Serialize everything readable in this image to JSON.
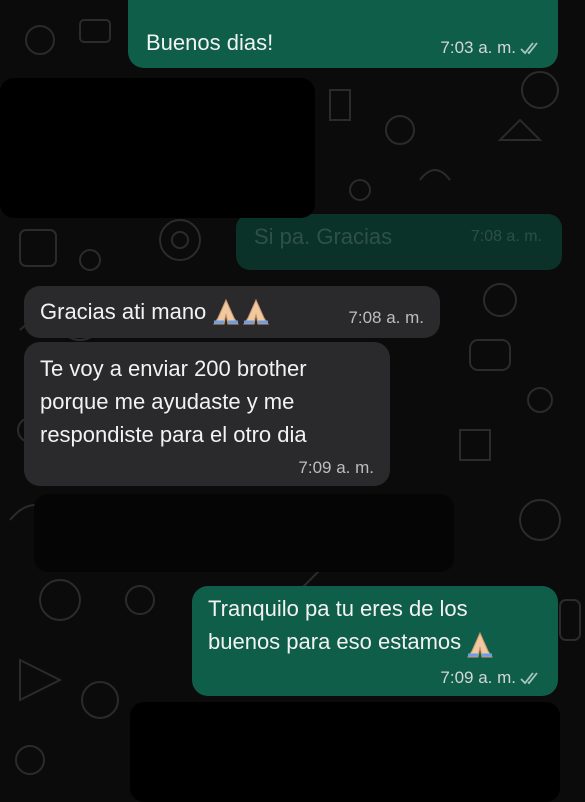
{
  "messages": [
    {
      "id": "m1",
      "side": "out",
      "text": "Buenos dias!",
      "time": "7:03 a. m.",
      "ticks": true
    },
    {
      "id": "m2",
      "side": "out",
      "text": "Si pa. Gracias",
      "time": "7:08 a. m.",
      "ticks": true,
      "blurred": true
    },
    {
      "id": "m3",
      "side": "in",
      "text": "Gracias ati mano",
      "emoji": "folded-hands-x2",
      "time": "7:08 a. m."
    },
    {
      "id": "m4",
      "side": "in",
      "text": "Te voy a enviar 200 brother\nporque me ayudaste y me\nrespondiste para el otro dia",
      "time": "7:09 a. m."
    },
    {
      "id": "m5",
      "side": "out",
      "text": "Tranquilo pa tu eres de los\nbuenos para eso estamos",
      "emoji": "folded-hands",
      "time": "7:09 a. m.",
      "ticks": true
    }
  ],
  "colors": {
    "background": "#0b0b0b",
    "outgoing": "#0f5e4a",
    "incoming": "#2a2a2c",
    "text": "#f2f2f2"
  },
  "icons": [
    "double-check-icon",
    "folded-hands-emoji"
  ]
}
